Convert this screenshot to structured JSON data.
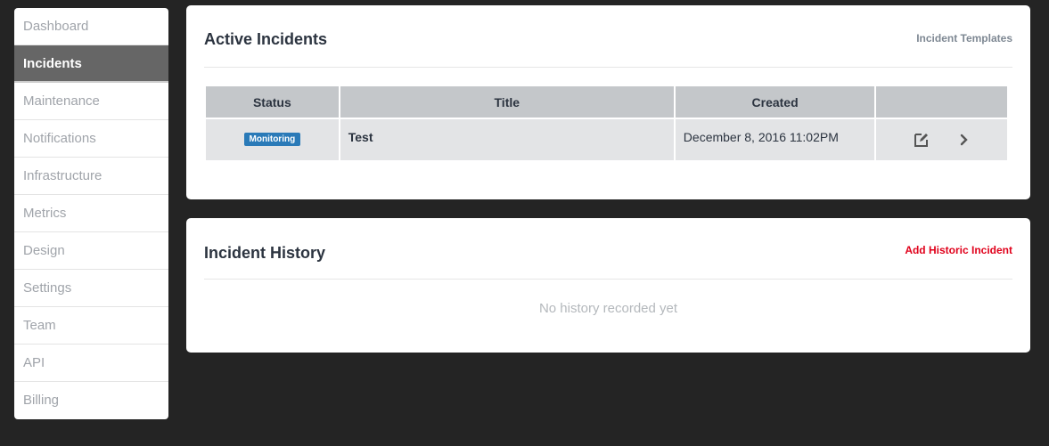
{
  "sidebar": {
    "items": [
      {
        "label": "Dashboard",
        "active": false
      },
      {
        "label": "Incidents",
        "active": true
      },
      {
        "label": "Maintenance",
        "active": false
      },
      {
        "label": "Notifications",
        "active": false
      },
      {
        "label": "Infrastructure",
        "active": false
      },
      {
        "label": "Metrics",
        "active": false
      },
      {
        "label": "Design",
        "active": false
      },
      {
        "label": "Settings",
        "active": false
      },
      {
        "label": "Team",
        "active": false
      },
      {
        "label": "API",
        "active": false
      },
      {
        "label": "Billing",
        "active": false
      }
    ]
  },
  "active_incidents": {
    "title": "Active Incidents",
    "link": "Incident Templates",
    "columns": [
      "Status",
      "Title",
      "Created",
      ""
    ],
    "rows": [
      {
        "status": "Monitoring",
        "status_color": "#2a7ab8",
        "title": "Test",
        "created": "December 8, 2016 11:02PM",
        "actions": [
          "edit-icon",
          "chevron-right-icon"
        ]
      }
    ]
  },
  "incident_history": {
    "title": "Incident History",
    "link": "Add Historic Incident",
    "link_color": "#e0001a",
    "empty_message": "No history recorded yet"
  }
}
